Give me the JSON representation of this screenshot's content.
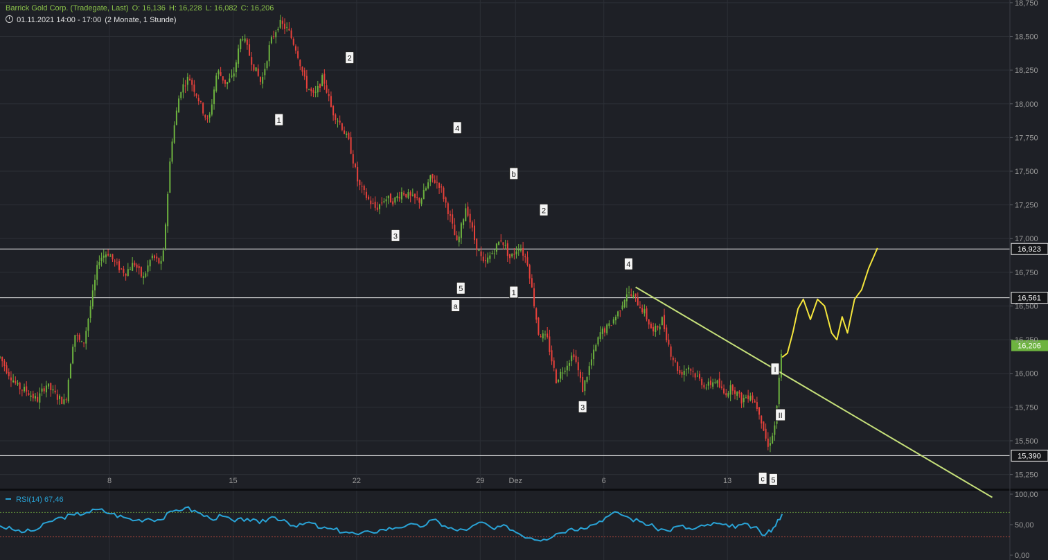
{
  "header": {
    "instrument": "Barrick Gold Corp. (Tradegate, Last)",
    "open": "O: 16,136",
    "high": "H: 16,228",
    "low": "L: 16,082",
    "close": "C: 16,206",
    "period": "01.11.2021 14:00 - 17:00",
    "range": "(2 Monate, 1 Stunde)"
  },
  "rsi_header": {
    "label": "RSI(14)",
    "value": "67,46"
  },
  "colors": {
    "background": "#1e2026",
    "grid": "#2c2f36",
    "up": "#6db33f",
    "down": "#e8413b",
    "trendline": "#c6e07a",
    "projection": "#f5e63c",
    "rsi": "#29a3d6",
    "current_badge": "#6db33f",
    "axis_text": "#9a9a9a"
  },
  "chart_data": [
    {
      "type": "candlestick",
      "title": "Barrick Gold Corp. (Tradegate, Last)",
      "ylim": [
        15.14,
        18.77
      ],
      "y_ticks": [
        15.25,
        15.5,
        15.75,
        16.0,
        16.25,
        16.5,
        16.75,
        17.0,
        17.25,
        17.5,
        17.75,
        18.0,
        18.25,
        18.5,
        18.75
      ],
      "y_tick_labels": [
        "15,250",
        "15,500",
        "15,750",
        "16,000",
        "16,250",
        "16,500",
        "16,750",
        "17,000",
        "17,250",
        "17,500",
        "17,750",
        "18,000",
        "18,250",
        "18,500",
        "18,750"
      ],
      "x_labels": [
        {
          "label": "8",
          "day": 7
        },
        {
          "label": "15",
          "day": 14
        },
        {
          "label": "22",
          "day": 21
        },
        {
          "label": "29",
          "day": 28
        },
        {
          "label": "Dez",
          "day": 30
        },
        {
          "label": "6",
          "day": 35
        },
        {
          "label": "13",
          "day": 42
        }
      ],
      "x_range_days": [
        0.8,
        58
      ],
      "last_day": 45.1,
      "price_path": [
        [
          0.8,
          16.12
        ],
        [
          1.3,
          16.0
        ],
        [
          1.8,
          15.9
        ],
        [
          2.3,
          15.87
        ],
        [
          2.9,
          15.8
        ],
        [
          3.4,
          15.92
        ],
        [
          4.0,
          15.83
        ],
        [
          4.5,
          15.78
        ],
        [
          5.0,
          16.3
        ],
        [
          5.5,
          16.2
        ],
        [
          6.0,
          16.55
        ],
        [
          6.4,
          16.85
        ],
        [
          6.9,
          16.9
        ],
        [
          7.4,
          16.8
        ],
        [
          7.9,
          16.75
        ],
        [
          8.4,
          16.82
        ],
        [
          8.9,
          16.7
        ],
        [
          9.4,
          16.87
        ],
        [
          10.0,
          16.8
        ],
        [
          10.5,
          17.7
        ],
        [
          11.0,
          18.1
        ],
        [
          11.5,
          18.2
        ],
        [
          12.0,
          18.05
        ],
        [
          12.6,
          17.85
        ],
        [
          13.1,
          18.25
        ],
        [
          13.6,
          18.15
        ],
        [
          14.0,
          18.2
        ],
        [
          14.5,
          18.52
        ],
        [
          15.1,
          18.3
        ],
        [
          15.6,
          18.15
        ],
        [
          16.1,
          18.45
        ],
        [
          16.6,
          18.6
        ],
        [
          17.1,
          18.55
        ],
        [
          17.6,
          18.4
        ],
        [
          18.1,
          18.15
        ],
        [
          18.6,
          18.05
        ],
        [
          19.1,
          18.2
        ],
        [
          19.6,
          17.95
        ],
        [
          20.1,
          17.85
        ],
        [
          20.6,
          17.7
        ],
        [
          21.1,
          17.4
        ],
        [
          21.6,
          17.3
        ],
        [
          22.1,
          17.22
        ],
        [
          22.6,
          17.3
        ],
        [
          23.1,
          17.28
        ],
        [
          23.6,
          17.35
        ],
        [
          24.1,
          17.3
        ],
        [
          24.6,
          17.28
        ],
        [
          25.2,
          17.45
        ],
        [
          25.7,
          17.4
        ],
        [
          26.2,
          17.2
        ],
        [
          26.7,
          16.95
        ],
        [
          27.2,
          17.25
        ],
        [
          27.7,
          16.98
        ],
        [
          28.2,
          16.8
        ],
        [
          28.7,
          16.9
        ],
        [
          29.2,
          17.0
        ],
        [
          29.7,
          16.85
        ],
        [
          30.2,
          16.95
        ],
        [
          30.7,
          16.82
        ],
        [
          31.3,
          16.3
        ],
        [
          31.8,
          16.25
        ],
        [
          32.3,
          15.95
        ],
        [
          32.8,
          16.05
        ],
        [
          33.3,
          16.15
        ],
        [
          33.8,
          15.88
        ],
        [
          34.3,
          16.1
        ],
        [
          34.8,
          16.3
        ],
        [
          35.3,
          16.35
        ],
        [
          35.8,
          16.45
        ],
        [
          36.3,
          16.6
        ],
        [
          36.8,
          16.55
        ],
        [
          37.3,
          16.45
        ],
        [
          37.8,
          16.3
        ],
        [
          38.3,
          16.4
        ],
        [
          38.8,
          16.15
        ],
        [
          39.3,
          16.0
        ],
        [
          39.8,
          16.05
        ],
        [
          40.3,
          15.97
        ],
        [
          40.8,
          15.9
        ],
        [
          41.3,
          15.95
        ],
        [
          41.8,
          15.85
        ],
        [
          42.3,
          15.9
        ],
        [
          42.8,
          15.8
        ],
        [
          43.3,
          15.85
        ],
        [
          43.8,
          15.72
        ],
        [
          44.3,
          15.45
        ],
        [
          44.7,
          15.62
        ],
        [
          45.1,
          16.2
        ]
      ],
      "horizontal_levels": [
        {
          "value": 16.923,
          "label": "16,923"
        },
        {
          "value": 16.561,
          "label": "16,561"
        },
        {
          "value": 15.39,
          "label": "15,390"
        }
      ],
      "current_price": {
        "value": 16.206,
        "label": "16,206"
      },
      "trendline": {
        "from": [
          36.8,
          16.64
        ],
        "to": [
          57.0,
          15.08
        ]
      },
      "projection": [
        [
          45.1,
          16.12
        ],
        [
          45.4,
          16.15
        ],
        [
          45.7,
          16.3
        ],
        [
          46.0,
          16.48
        ],
        [
          46.3,
          16.55
        ],
        [
          46.7,
          16.4
        ],
        [
          47.1,
          16.55
        ],
        [
          47.5,
          16.5
        ],
        [
          47.9,
          16.3
        ],
        [
          48.2,
          16.25
        ],
        [
          48.5,
          16.42
        ],
        [
          48.8,
          16.3
        ],
        [
          49.2,
          16.55
        ],
        [
          49.6,
          16.62
        ],
        [
          50.0,
          16.78
        ],
        [
          50.5,
          16.93
        ]
      ],
      "wave_labels": [
        {
          "label": "2",
          "day": 20.6,
          "value": 18.34
        },
        {
          "label": "1",
          "day": 16.6,
          "value": 17.88
        },
        {
          "label": "4",
          "day": 26.7,
          "value": 17.82
        },
        {
          "label": "b",
          "day": 29.9,
          "value": 17.48
        },
        {
          "label": "3",
          "day": 23.2,
          "value": 17.02
        },
        {
          "label": "2",
          "day": 31.6,
          "value": 17.21
        },
        {
          "label": "5",
          "day": 26.9,
          "value": 16.63
        },
        {
          "label": "1",
          "day": 29.9,
          "value": 16.6
        },
        {
          "label": "a",
          "day": 26.6,
          "value": 16.5
        },
        {
          "label": "4",
          "day": 36.4,
          "value": 16.81
        },
        {
          "label": "3",
          "day": 33.8,
          "value": 15.75
        },
        {
          "label": "I",
          "day": 44.7,
          "value": 16.03
        },
        {
          "label": "II",
          "day": 45.0,
          "value": 15.69
        },
        {
          "label": "c",
          "day": 44.0,
          "value": 15.22
        },
        {
          "label": "5",
          "day": 44.6,
          "value": 15.21
        }
      ]
    },
    {
      "type": "line",
      "title": "RSI(14)",
      "ylim": [
        0,
        100
      ],
      "y_tick_labels": [
        "100,00",
        "50,00",
        "0,00"
      ],
      "y_ticks": [
        100,
        50,
        0
      ],
      "overbought": 70,
      "oversold": 30,
      "last_value": 67.46,
      "x_range_days": [
        0.8,
        58
      ],
      "series": [
        [
          0.8,
          48
        ],
        [
          1.5,
          42
        ],
        [
          2.2,
          38
        ],
        [
          2.9,
          42
        ],
        [
          3.6,
          55
        ],
        [
          4.3,
          62
        ],
        [
          5.0,
          66
        ],
        [
          5.7,
          70
        ],
        [
          6.4,
          75
        ],
        [
          7.1,
          68
        ],
        [
          7.8,
          62
        ],
        [
          8.5,
          57
        ],
        [
          9.2,
          60
        ],
        [
          9.9,
          58
        ],
        [
          10.6,
          72
        ],
        [
          11.3,
          78
        ],
        [
          12.0,
          70
        ],
        [
          12.7,
          60
        ],
        [
          13.4,
          64
        ],
        [
          14.1,
          55
        ],
        [
          14.8,
          60
        ],
        [
          15.5,
          52
        ],
        [
          16.2,
          63
        ],
        [
          16.9,
          58
        ],
        [
          17.6,
          46
        ],
        [
          18.3,
          54
        ],
        [
          19.0,
          44
        ],
        [
          19.7,
          42
        ],
        [
          20.4,
          38
        ],
        [
          21.1,
          34
        ],
        [
          21.8,
          38
        ],
        [
          22.5,
          42
        ],
        [
          23.2,
          45
        ],
        [
          23.9,
          50
        ],
        [
          24.6,
          46
        ],
        [
          25.3,
          58
        ],
        [
          26.0,
          48
        ],
        [
          26.7,
          40
        ],
        [
          27.4,
          44
        ],
        [
          28.1,
          54
        ],
        [
          28.8,
          42
        ],
        [
          29.5,
          48
        ],
        [
          30.2,
          35
        ],
        [
          30.9,
          28
        ],
        [
          31.6,
          26
        ],
        [
          32.3,
          35
        ],
        [
          33.0,
          42
        ],
        [
          33.7,
          45
        ],
        [
          34.4,
          50
        ],
        [
          35.1,
          62
        ],
        [
          35.8,
          70
        ],
        [
          36.5,
          60
        ],
        [
          37.2,
          54
        ],
        [
          37.9,
          45
        ],
        [
          38.6,
          40
        ],
        [
          39.3,
          48
        ],
        [
          40.0,
          42
        ],
        [
          40.7,
          48
        ],
        [
          41.4,
          52
        ],
        [
          42.1,
          46
        ],
        [
          42.8,
          50
        ],
        [
          43.5,
          46
        ],
        [
          44.1,
          32
        ],
        [
          44.6,
          45
        ],
        [
          45.1,
          67.46
        ]
      ]
    }
  ]
}
